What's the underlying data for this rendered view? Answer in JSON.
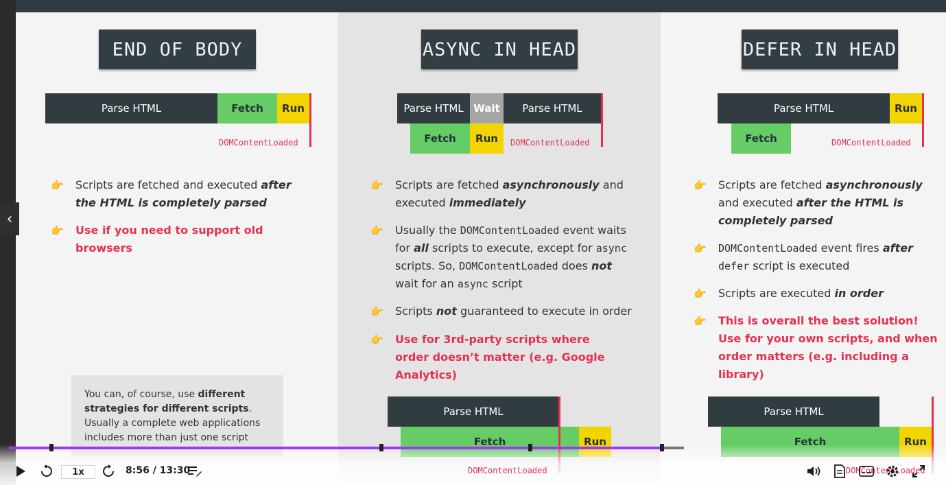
{
  "columns": [
    {
      "title": "END OF BODY",
      "bar": {
        "parse": "Parse HTML",
        "fetch": "Fetch",
        "run": "Run",
        "dcl": "DOMContentLoaded"
      },
      "bullets": [
        {
          "text_a": "Scripts are fetched and executed ",
          "text_b": "after the HTML is completely parsed"
        },
        {
          "text_a": "Use if you need to support old browsers"
        }
      ]
    },
    {
      "title": "ASYNC IN HEAD",
      "bar": {
        "parse1": "Parse HTML",
        "wait": "Wait",
        "parse2": "Parse HTML",
        "fetch": "Fetch",
        "run": "Run",
        "dcl": "DOMContentLoaded"
      },
      "bullets": [
        {
          "a": "Scripts are fetched ",
          "b": "asynchronously",
          "c": " and executed ",
          "d": "immediately"
        },
        {
          "a": "Usually the ",
          "m1": "DOMContentLoaded",
          "b": " event waits for ",
          "c": "all",
          "d": " scripts to execute, except for ",
          "m2": "async",
          "e": " scripts. So, ",
          "m3": "DOMContentLoaded",
          "f": " does ",
          "g": "not",
          "h": " wait for an ",
          "m4": "async",
          "i": " script"
        },
        {
          "a": "Scripts ",
          "b": "not",
          "c": " guaranteed to execute in order"
        },
        {
          "a": "Use for 3rd-party scripts where order doesn’t matter (e.g. Google Analytics)"
        }
      ],
      "bottom_bar": {
        "parse": "Parse HTML",
        "fetch": "Fetch",
        "run": "Run",
        "dcl": "DOMContentLoaded"
      }
    },
    {
      "title": "DEFER IN HEAD",
      "bar": {
        "parse": "Parse HTML",
        "run": "Run",
        "fetch": "Fetch",
        "dcl": "DOMContentLoaded"
      },
      "bullets": [
        {
          "a": "Scripts are fetched ",
          "b": "asynchronously",
          "c": " and executed ",
          "d": "after the HTML is completely parsed"
        },
        {
          "m1": "DOMContentLoaded",
          "a": " event fires ",
          "b": "after",
          "m2": "defer",
          "c": " script is executed"
        },
        {
          "a": "Scripts are executed ",
          "b": "in order"
        },
        {
          "a": "This is overall the best solution! Use for your own scripts, and when order matters (e.g. including a library)"
        }
      ],
      "bottom_bar": {
        "parse": "Parse HTML",
        "fetch": "Fetch",
        "run": "Run",
        "dcl": "DOMContentLoaded"
      }
    }
  ],
  "note": {
    "a": "You can, of course, use ",
    "b": "different strategies for different scripts",
    "c": ". Usually a complete web applications includes more than just one script"
  },
  "player": {
    "speed": "1x",
    "time": "8:56 / 13:30",
    "progress_fraction": 0.676,
    "icons": [
      "play-icon",
      "rewind-5-icon",
      "forward-5-icon",
      "notes-icon",
      "volume-icon",
      "transcript-icon",
      "captions-icon",
      "settings-icon",
      "fullscreen-icon"
    ]
  },
  "colors": {
    "accent": "#a435f0",
    "red": "#e53150",
    "green": "#66cc66",
    "yellow": "#f2d500",
    "dark": "#313c41"
  }
}
